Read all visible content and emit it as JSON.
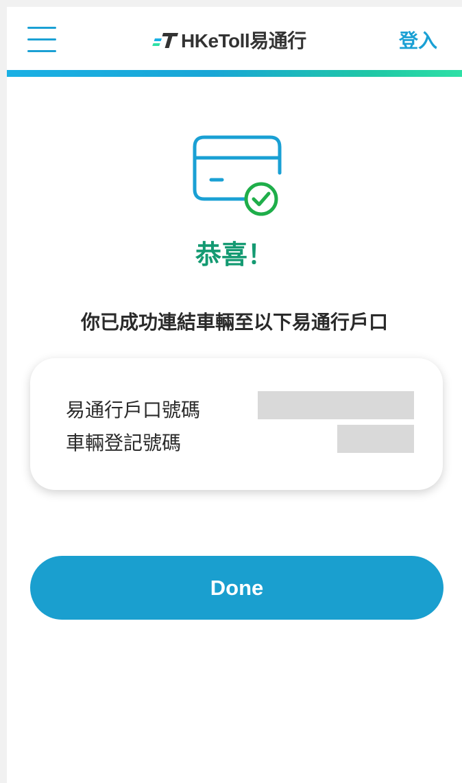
{
  "header": {
    "logo_text": "HKeToll易通行",
    "login_label": "登入",
    "icons": {
      "menu": "hamburger-menu-icon",
      "logo_mark": "hketoll-logo-icon"
    }
  },
  "main": {
    "status_icon": "card-check-icon",
    "title": "恭喜！",
    "message": "你已成功連結車輛至以下易通行戶口",
    "details": {
      "account_label": "易通行戶口號碼",
      "account_value": "",
      "plate_label": "車輛登記號碼",
      "plate_value": ""
    },
    "done_label": "Done"
  },
  "colors": {
    "accent": "#1aa0d4",
    "success": "#149a72",
    "check_green": "#1fae4a",
    "button": "#1a9fcf"
  }
}
